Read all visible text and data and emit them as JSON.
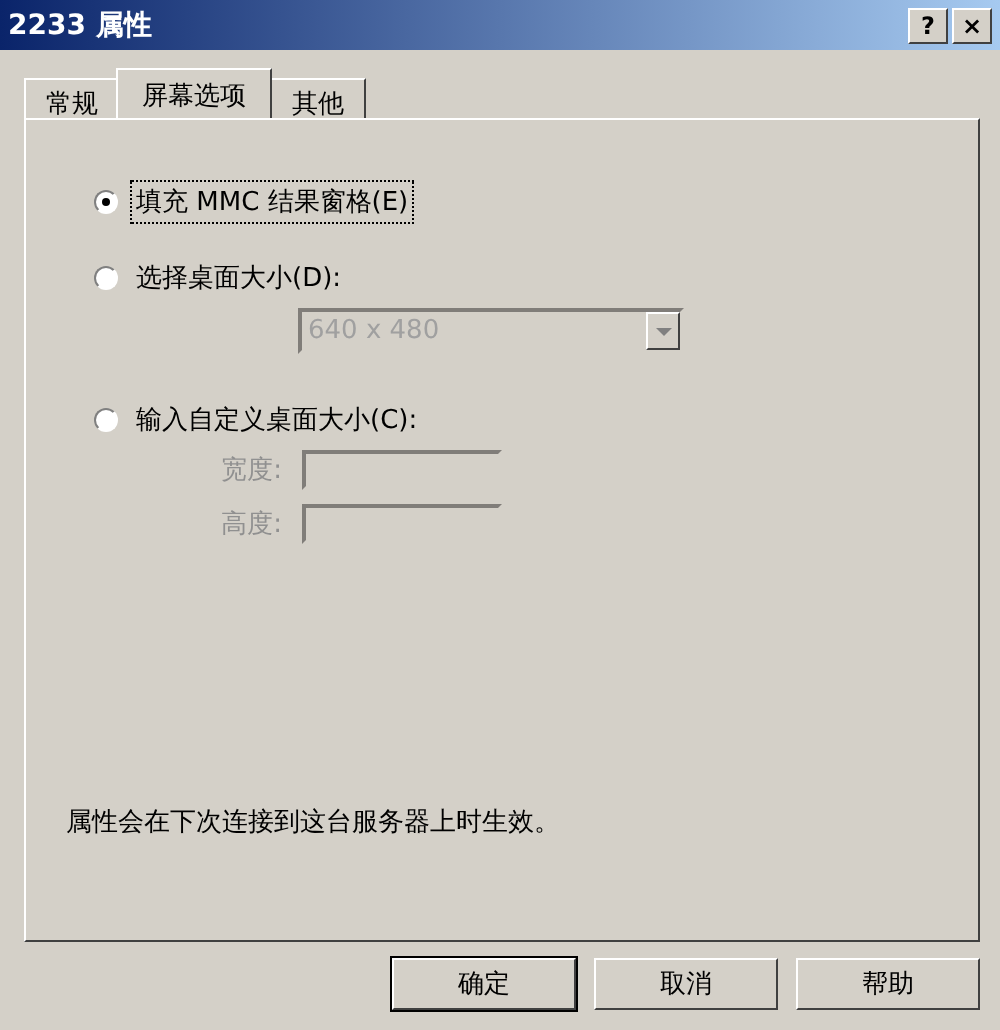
{
  "window": {
    "title": "2233 属性",
    "help_button": "?",
    "close_button": "×"
  },
  "tabs": [
    {
      "label": "常规",
      "selected": false
    },
    {
      "label": "屏幕选项",
      "selected": true
    },
    {
      "label": "其他",
      "selected": false
    }
  ],
  "options": [
    {
      "label": "填充 MMC 结果窗格(E)",
      "selected": true,
      "focused": true
    },
    {
      "label": "选择桌面大小(D):",
      "selected": false,
      "focused": false
    },
    {
      "label": "输入自定义桌面大小(C):",
      "selected": false,
      "focused": false
    }
  ],
  "size_dropdown": {
    "value": "640 x 480",
    "disabled": true
  },
  "custom_fields": [
    {
      "label": "宽度:",
      "disabled": true
    },
    {
      "label": "高度:",
      "disabled": true
    }
  ],
  "note": "属性会在下次连接到这台服务器上时生效。",
  "buttons": [
    "确定",
    "取消",
    "帮助"
  ]
}
